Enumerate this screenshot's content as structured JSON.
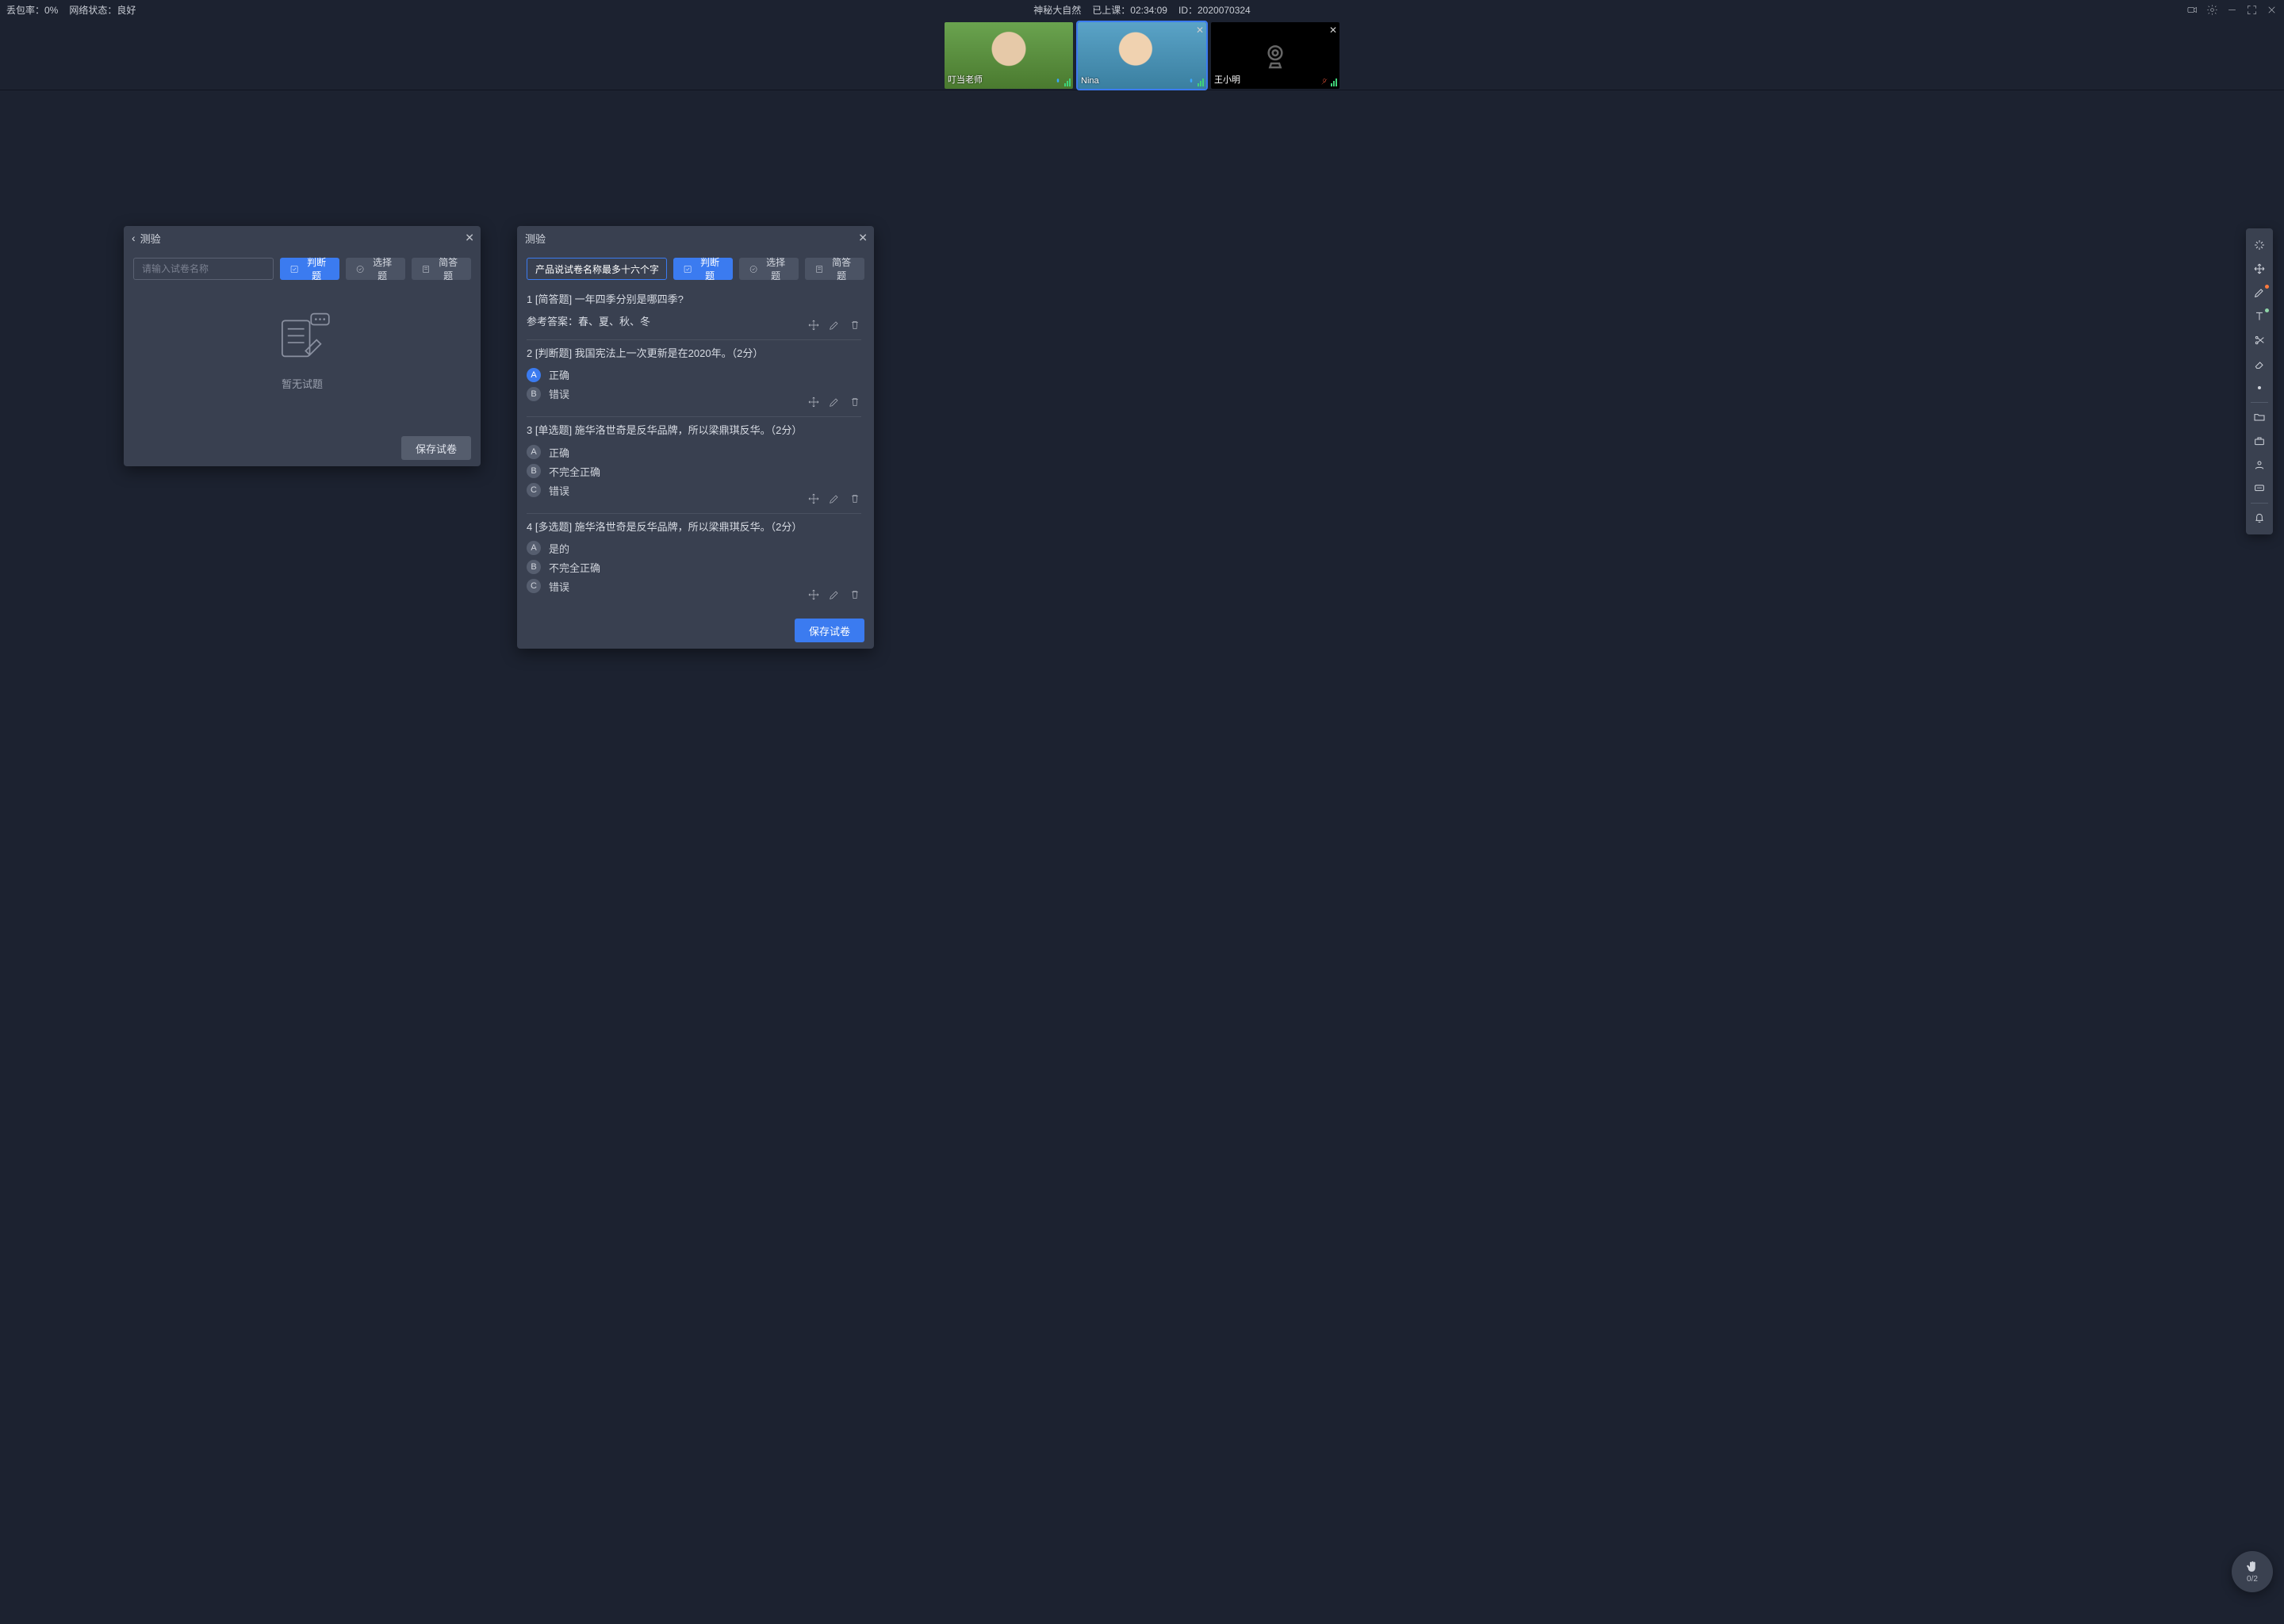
{
  "topbar": {
    "packet_loss_label": "丢包率：0%",
    "network_label": "网络状态：良好",
    "title": "神秘大自然",
    "elapsed_label": "已上课：02:34:09",
    "id_label": "ID：2020070324"
  },
  "videos": [
    {
      "name": "叮当老师",
      "selected": false,
      "muted": false,
      "cam_on": true,
      "closeable": false
    },
    {
      "name": "Nina",
      "selected": true,
      "muted": false,
      "cam_on": true,
      "closeable": true
    },
    {
      "name": "王小明",
      "selected": false,
      "muted": true,
      "cam_on": false,
      "closeable": true
    }
  ],
  "panel_left": {
    "title": "测验",
    "name_placeholder": "请输入试卷名称",
    "name_value": "",
    "btn_true_false": "判断题",
    "btn_choice": "选择题",
    "btn_short": "简答题",
    "empty_text": "暂无试题",
    "save": "保存试卷"
  },
  "panel_right": {
    "title": "测验",
    "name_value": "产品说试卷名称最多十六个字",
    "btn_true_false": "判断题",
    "btn_choice": "选择题",
    "btn_short": "简答题",
    "answer_prefix": "参考答案：",
    "save": "保存试卷",
    "questions": [
      {
        "idx": "1",
        "type_label": "[简答题]",
        "text": "一年四季分别是哪四季?",
        "answer": "春、夏、秋、冬"
      },
      {
        "idx": "2",
        "type_label": "[判断题]",
        "text": "我国宪法上一次更新是在2020年。（2分）",
        "options": [
          {
            "badge": "A",
            "text": "正确",
            "correct": true
          },
          {
            "badge": "B",
            "text": "错误",
            "correct": false
          }
        ]
      },
      {
        "idx": "3",
        "type_label": "[单选题]",
        "text": "施华洛世奇是反华品牌，所以梁鼎琪反华。（2分）",
        "options": [
          {
            "badge": "A",
            "text": "正确",
            "correct": false
          },
          {
            "badge": "B",
            "text": "不完全正确",
            "correct": false
          },
          {
            "badge": "C",
            "text": "错误",
            "correct": false
          }
        ]
      },
      {
        "idx": "4",
        "type_label": "[多选题]",
        "text": "施华洛世奇是反华品牌，所以梁鼎琪反华。（2分）",
        "options": [
          {
            "badge": "A",
            "text": "是的",
            "correct": false
          },
          {
            "badge": "B",
            "text": "不完全正确",
            "correct": false
          },
          {
            "badge": "C",
            "text": "错误",
            "correct": false
          }
        ]
      }
    ]
  },
  "hand": {
    "count": "0/2"
  }
}
